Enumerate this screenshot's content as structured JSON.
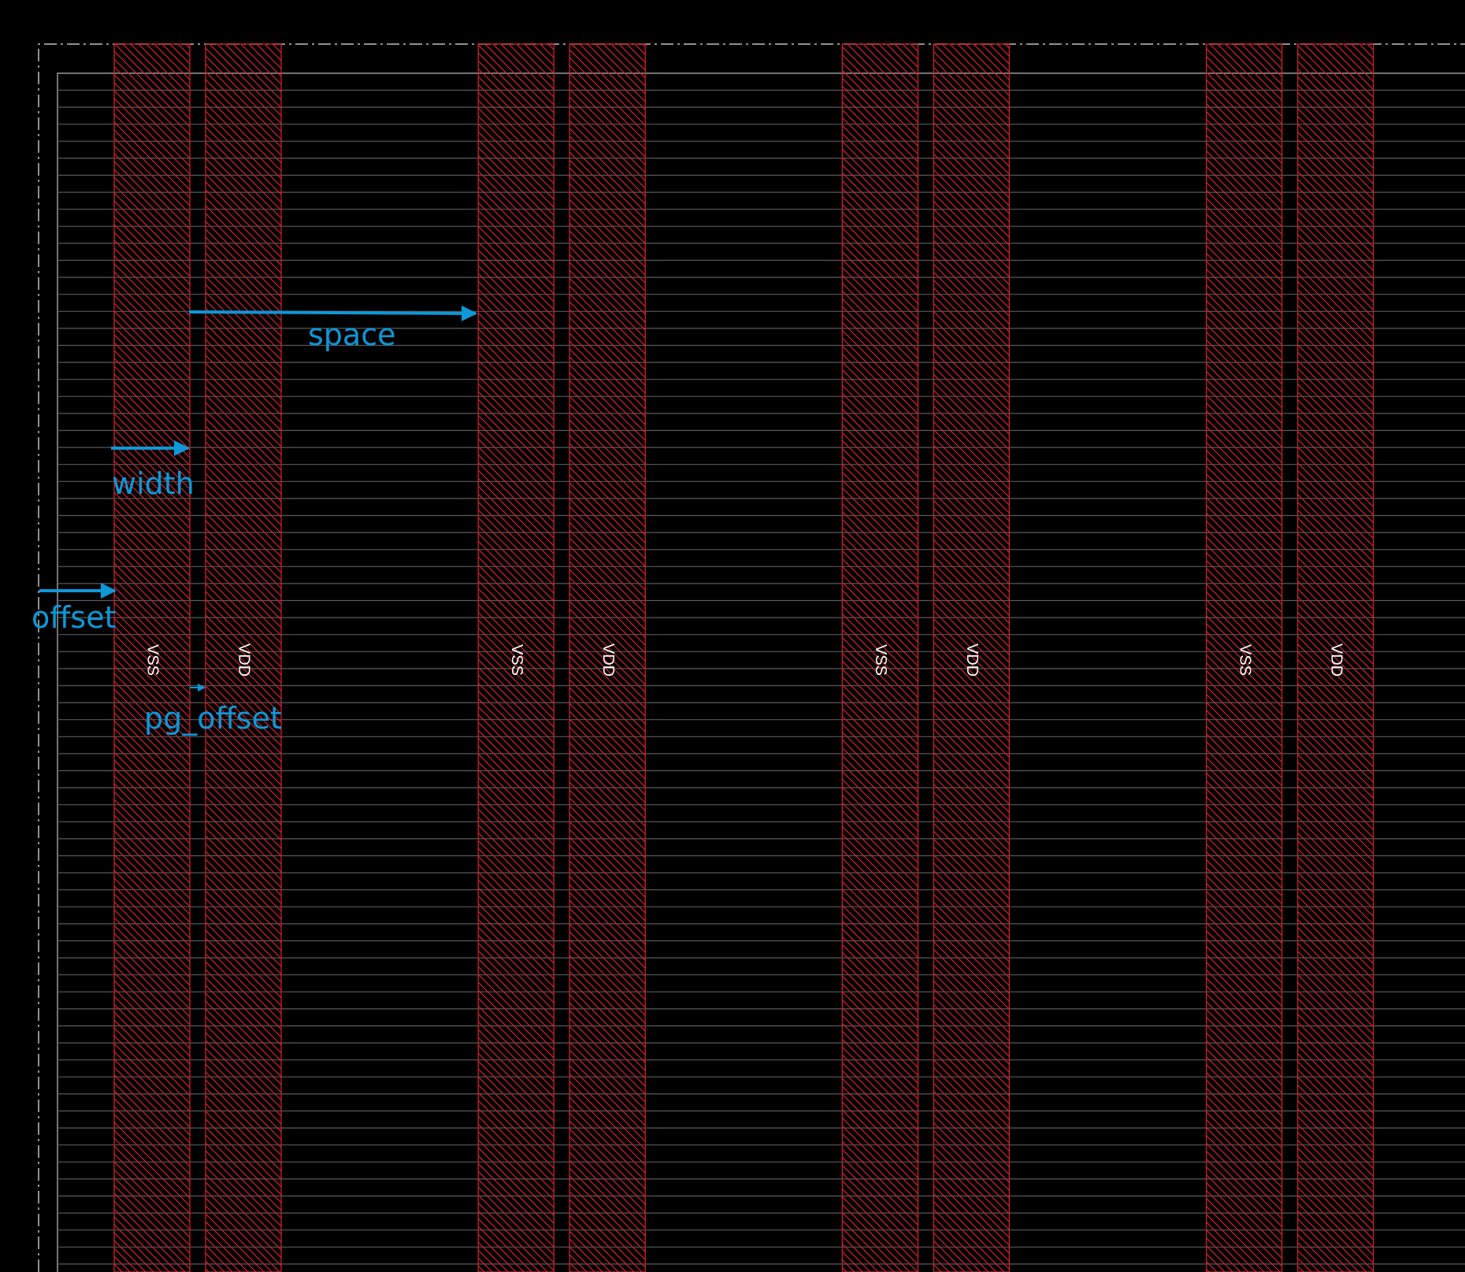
{
  "colors": {
    "background": "#000000",
    "boundary": "#bfbfbf",
    "row_line": "#5a5a5a",
    "stripe": "#d2202a",
    "annotation": "#0d98d8",
    "net_label": "#ffffff"
  },
  "stripes": [
    {
      "net": "VSS"
    },
    {
      "net": "VDD"
    },
    {
      "net": "VSS"
    },
    {
      "net": "VDD"
    },
    {
      "net": "VSS"
    },
    {
      "net": "VDD"
    },
    {
      "net": "VSS"
    },
    {
      "net": "VDD"
    }
  ],
  "annotations": {
    "space": "space",
    "width": "width",
    "offset": "offset",
    "pg_offset": "pg_offset"
  },
  "icons": {
    "dimension_arrow": "arrow-right-icon"
  }
}
